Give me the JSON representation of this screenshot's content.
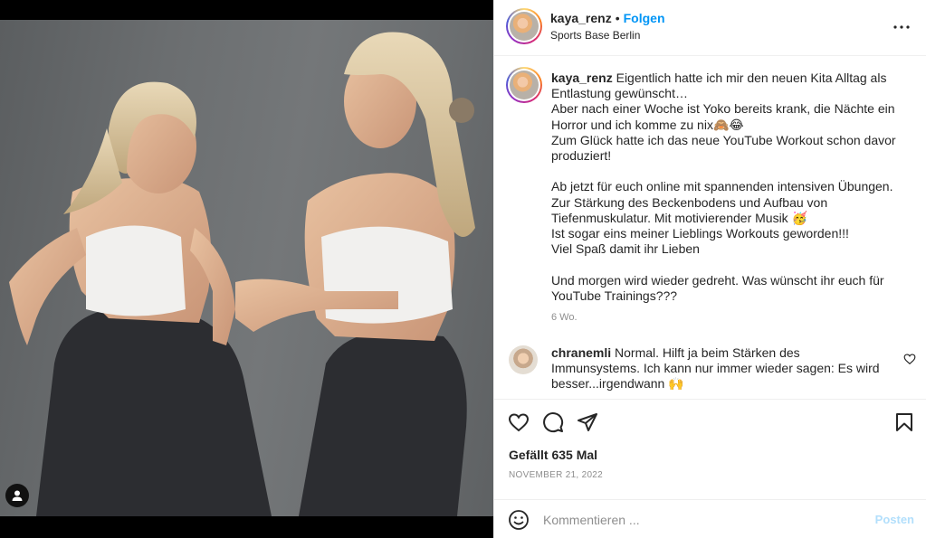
{
  "post": {
    "username": "kaya_renz",
    "follow_label": "Folgen",
    "separator": "•",
    "location": "Sports Base Berlin",
    "more_icon": "more-horizontal-icon"
  },
  "caption": {
    "username": "kaya_renz",
    "text": " Eigentlich hatte ich mir den neuen Kita Alltag als Entlastung gewünscht…\nAber nach einer Woche ist Yoko bereits krank, die Nächte ein Horror und ich komme zu nix🙈😂\nZum Glück hatte ich das neue YouTube Workout schon davor produziert!\n\nAb jetzt für euch online mit spannenden intensiven Übungen. Zur Stärkung des Beckenbodens und Aufbau von Tiefenmuskulatur. Mit motivierender Musik 🥳\nIst sogar eins meiner Lieblings Workouts geworden!!!\nViel Spaß damit ihr Lieben\n\nUnd morgen wird wieder gedreht. Was wünscht ihr euch für YouTube Trainings???",
    "time": "6 Wo."
  },
  "comments": [
    {
      "username": "chranemli",
      "text": " Normal. Hilft ja beim Stärken des Immunsystems. Ich kann nur immer wieder sagen: Es wird besser...irgendwann 🙌"
    }
  ],
  "actions": {
    "like_icon": "heart-icon",
    "comment_icon": "comment-icon",
    "share_icon": "share-icon",
    "save_icon": "bookmark-icon"
  },
  "likes": "Gefällt 635 Mal",
  "date": "NOVEMBER 21, 2022",
  "comment_box": {
    "placeholder": "Kommentieren ...",
    "post_label": "Posten",
    "emoji_icon": "emoji-icon"
  },
  "colors": {
    "link": "#0095f6",
    "post_disabled": "#b2dffc",
    "muted": "#8e8e8e",
    "text": "#262626"
  }
}
